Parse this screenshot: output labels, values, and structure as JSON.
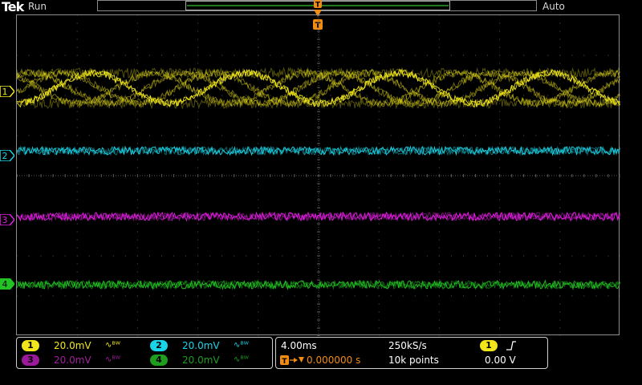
{
  "header": {
    "brand": "Tek",
    "acq_state": "Run",
    "trigger_mode": "Auto"
  },
  "colors": {
    "ch1": "#f1e71a",
    "ch2": "#19d4e6",
    "ch3": "#e51de5",
    "ch4": "#22c322",
    "trigger": "#f28c12",
    "grid": "#5a5a5a"
  },
  "channels": [
    {
      "num": "1",
      "scale": "20.0mV",
      "bw": "∿ᴮᵂ"
    },
    {
      "num": "2",
      "scale": "20.0mV",
      "bw": "∿ᴮᵂ"
    },
    {
      "num": "3",
      "scale": "20.0mV",
      "bw": "∿ᴮᵂ"
    },
    {
      "num": "4",
      "scale": "20.0mV",
      "bw": "∿ᴮᵂ"
    }
  ],
  "horizontal": {
    "time_per_div": "4.00ms",
    "sample_rate": "250kS/s",
    "delay": "0.000000 s",
    "record_length": "10k points"
  },
  "trigger": {
    "source": "1",
    "slope_icon": "rising-edge-icon",
    "level": "0.00 V",
    "marker": "T"
  }
}
